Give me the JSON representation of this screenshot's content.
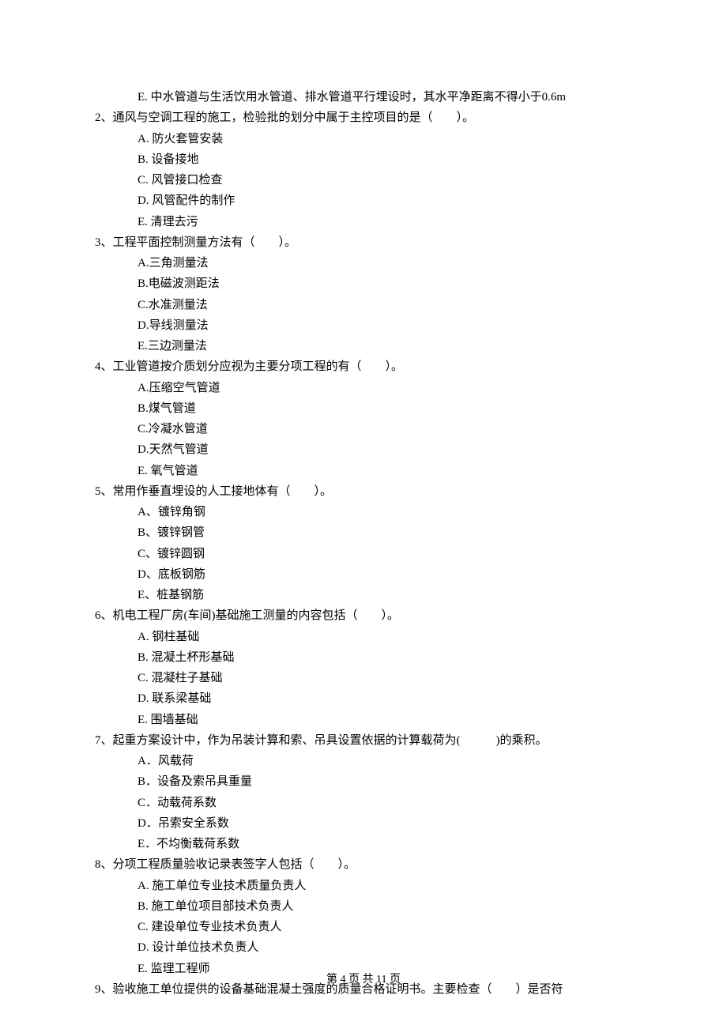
{
  "lead_option": "E.  中水管道与生活饮用水管道、排水管道平行埋设时，其水平净距离不得小于0.6m",
  "questions": [
    {
      "stem": "2、通风与空调工程的施工，检验批的划分中属于主控项目的是（　　）。",
      "options": [
        "A.  防火套管安装",
        "B.  设备接地",
        "C.  风管接口检查",
        "D.  风管配件的制作",
        "E.  清理去污"
      ]
    },
    {
      "stem": "3、工程平面控制测量方法有（　　）。",
      "options": [
        "A.三角测量法",
        "B.电磁波测距法",
        "C.水准测量法",
        "D.导线测量法",
        "E.三边测量法"
      ]
    },
    {
      "stem": "4、工业管道按介质划分应视为主要分项工程的有（　　）。",
      "options": [
        "A.压缩空气管道",
        "B.煤气管道",
        "C.冷凝水管道",
        "D.天然气管道",
        "E. 氧气管道"
      ]
    },
    {
      "stem": "5、常用作垂直埋设的人工接地体有（　　）。",
      "options": [
        "A、镀锌角钢",
        "B、镀锌钢管",
        "C、镀锌圆钢",
        "D、底板钢筋",
        "E、桩基钢筋"
      ]
    },
    {
      "stem": "6、机电工程厂房(车间)基础施工测量的内容包括（　　）。",
      "options": [
        "A.  钢柱基础",
        "B.  混凝土杯形基础",
        "C.  混凝柱子基础",
        "D.  联系梁基础",
        "E.  围墙基础"
      ]
    },
    {
      "stem": "7、起重方案设计中，作为吊装计算和索、吊具设置依据的计算载荷为(　　　)的乘积。",
      "options": [
        "A．风载荷",
        "B．设备及索吊具重量",
        "C．动载荷系数",
        "D．吊索安全系数",
        "E．不均衡载荷系数"
      ]
    },
    {
      "stem": "8、分项工程质量验收记录表签字人包括（　　）。",
      "options": [
        "A.  施工单位专业技术质量负责人",
        "B.  施工单位项目部技术负责人",
        "C.  建设单位专业技术负责人",
        "D.  设计单位技术负责人",
        "E.  监理工程师"
      ]
    },
    {
      "stem": "9、验收施工单位提供的设备基础混凝土强度的质量合格证明书。主要检查（　　）是否符",
      "options": []
    }
  ],
  "footer": "第 4 页 共 11 页"
}
